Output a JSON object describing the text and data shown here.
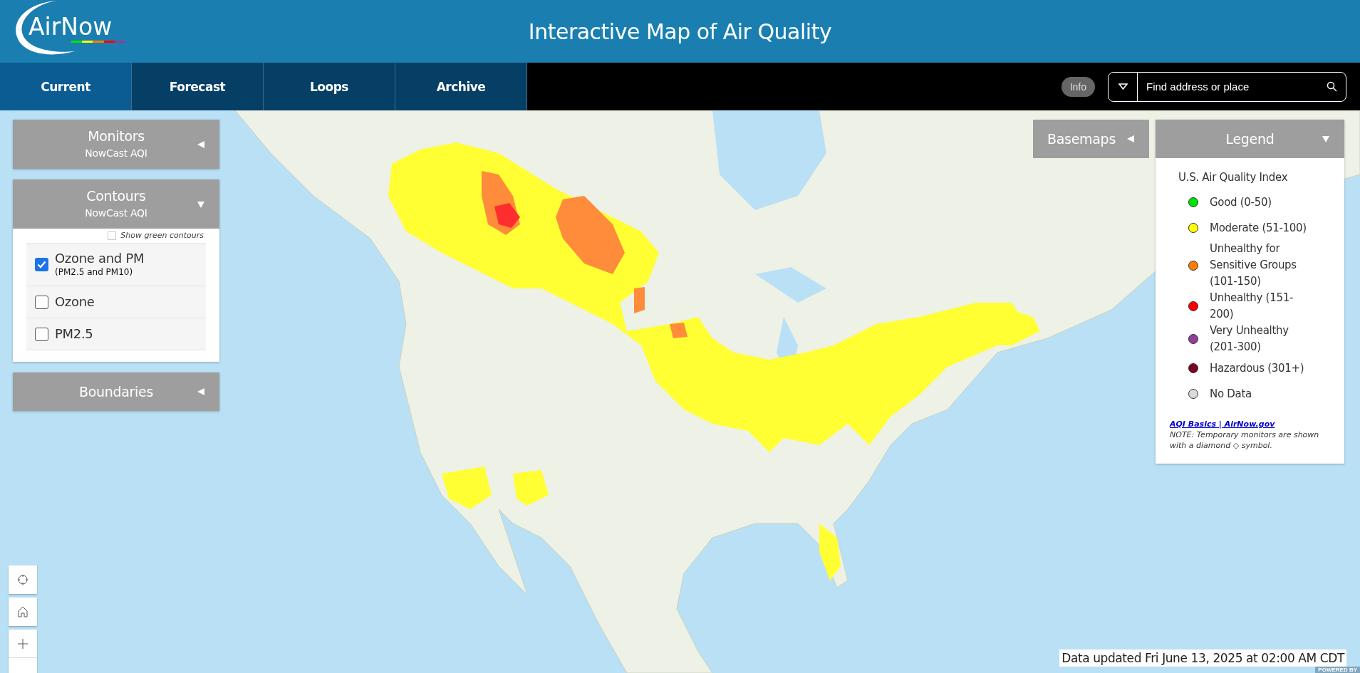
{
  "header": {
    "logo": "AirNow",
    "title": "Interactive Map of Air Quality"
  },
  "tabs": [
    {
      "label": "Current",
      "selected": true
    },
    {
      "label": "Forecast",
      "selected": false
    },
    {
      "label": "Loops",
      "selected": false
    },
    {
      "label": "Archive",
      "selected": false
    }
  ],
  "info_button": "Info",
  "search": {
    "placeholder": "Find address or place"
  },
  "monitors": {
    "title": "Monitors",
    "subtitle": "NowCast AQI",
    "expanded": false
  },
  "contours": {
    "title": "Contours",
    "subtitle": "NowCast AQI",
    "expanded": true,
    "show_green": {
      "label": "Show green contours",
      "checked": false
    },
    "options": [
      {
        "label": "Ozone and PM",
        "sublabel": "(PM2.5 and PM10)",
        "checked": true
      },
      {
        "label": "Ozone",
        "checked": false
      },
      {
        "label": "PM2.5",
        "checked": false
      }
    ]
  },
  "boundaries": {
    "title": "Boundaries",
    "expanded": false
  },
  "basemaps": {
    "title": "Basemaps",
    "expanded": false
  },
  "legend": {
    "title": "Legend",
    "expanded": true,
    "heading": "U.S. Air Quality Index",
    "items": [
      {
        "label": "Good (0-50)",
        "color": "#00e400"
      },
      {
        "label": "Moderate (51-100)",
        "color": "#ffff00"
      },
      {
        "label": "Unhealthy for Sensitive Groups (101-150)",
        "color": "#ff7e00"
      },
      {
        "label": "Unhealthy (151-200)",
        "color": "#ff0000"
      },
      {
        "label": "Very Unhealthy (201-300)",
        "color": "#8f3f97"
      },
      {
        "label": "Hazardous (301+)",
        "color": "#7e0023"
      },
      {
        "label": "No Data",
        "color": "#d9d9d9"
      }
    ],
    "link": "AQI Basics | AirNow.gov",
    "note": "NOTE: Temporary monitors are shown with a diamond ◇ symbol."
  },
  "data_updated": "Data updated Fri June 13, 2025 at 02:00 AM CDT",
  "powered_by": "POWERED BY"
}
